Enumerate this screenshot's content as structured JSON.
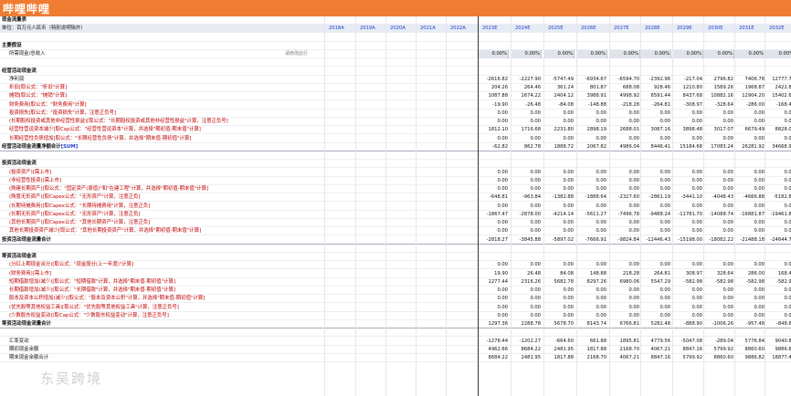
{
  "app_title": "哔哩哔哩",
  "sheet_title": "现金流量表",
  "unit_label": "单位：百万元人民币（特别说明除外）",
  "years": [
    "2018A",
    "2019A",
    "2020A",
    "2021A",
    "2022A",
    "2023E",
    "2024E",
    "2025E",
    "2026E",
    "2027E",
    "2028E",
    "2029E",
    "2030E",
    "2031E",
    "2032E"
  ],
  "percent_row_note": "请修改此行",
  "rows": [
    {
      "label": "",
      "style": ""
    },
    {
      "label": "主要假设",
      "style": "bold"
    },
    {
      "label": "所需现金/总收入",
      "style": "i1",
      "note": "请修改此行",
      "pct": true,
      "values": [
        "",
        "",
        "",
        "",
        "",
        "0.00%",
        "0.00%",
        "0.00%",
        "0.00%",
        "0.00%",
        "0.00%",
        "0.00%",
        "0.00%",
        "0.00%",
        "0.00%"
      ]
    },
    {
      "label": "",
      "style": ""
    },
    {
      "label": "经营活动现金流",
      "style": "bold"
    },
    {
      "label": "净利润",
      "style": "i1",
      "values": [
        "",
        "",
        "",
        "",
        "",
        "-2616.82",
        "-2227.90",
        "-5747.49",
        "-6934.67",
        "-6594.70",
        "-2392.96",
        "-217.04",
        "2796.82",
        "7406.78",
        "12777.78"
      ]
    },
    {
      "label": "折旧[取公式：\"折旧\"计算]",
      "style": "i1 red",
      "values": [
        "",
        "",
        "",
        "",
        "",
        "204.26",
        "264.46",
        "361.24",
        "801.87",
        "688.08",
        "928.46",
        "1210.80",
        "1589.26",
        "1968.87",
        "2422.87"
      ]
    },
    {
      "label": "摊销[取公式：\"摊销\"计算]",
      "style": "i1 red",
      "values": [
        "",
        "",
        "",
        "",
        "",
        "1087.88",
        "1674.22",
        "2404.12",
        "3988.91",
        "4998.92",
        "6591.44",
        "8437.68",
        "10882.16",
        "12904.20",
        "15402.68"
      ]
    },
    {
      "label": "财务费用[取公式：\"财务费用\"计算]",
      "style": "i1 red",
      "values": [
        "",
        "",
        "",
        "",
        "",
        "-19.90",
        "-26.48",
        "-84.08",
        "-148.88",
        "-218.28",
        "-264.81",
        "-308.97",
        "-328.64",
        "-286.00",
        "-168.46"
      ]
    },
    {
      "label": "投资损失[取公式：\"投资损失\"计算，注意正负号]",
      "style": "i1 red",
      "values": [
        "",
        "",
        "",
        "",
        "",
        "0.00",
        "0.00",
        "0.00",
        "0.00",
        "0.00",
        "0.00",
        "0.00",
        "0.00",
        "0.00",
        "0.00"
      ]
    },
    {
      "label": "(长期股权投资或其他非经营性损益)[取公式：\"长期股权投资或其他非经营性损益\"计算，注意正负号]",
      "style": "i1 red",
      "values": [
        "",
        "",
        "",
        "",
        "",
        "0.00",
        "0.00",
        "0.00",
        "0.00",
        "0.00",
        "0.00",
        "0.00",
        "0.00",
        "0.00",
        "0.00"
      ]
    },
    {
      "label": "经营性营运资本减少[取Cap公式：\"经营性营运资本\"计算，并选择\"期初值-期末值\"计算]",
      "style": "i1 red",
      "values": [
        "",
        "",
        "",
        "",
        "",
        "1812.10",
        "1716.68",
        "2231.80",
        "2898.19",
        "2688.01",
        "3087.16",
        "3898.48",
        "3017.07",
        "6679.49",
        "8828.07"
      ]
    },
    {
      "label": "长期经营性负债增加[取公式：\"长期经营性负债\"计算，并选择\"期末值-期初值\"计算]",
      "style": "i1 red",
      "values": [
        "",
        "",
        "",
        "",
        "",
        "0.00",
        "0.00",
        "0.00",
        "0.00",
        "0.00",
        "0.00",
        "0.00",
        "0.00",
        "0.00",
        "0.00"
      ]
    },
    {
      "label": "经营活动现金流量净额合计[SUM]",
      "style": "bold sum",
      "blueSuffix": "[SUM]",
      "values": [
        "",
        "",
        "",
        "",
        "",
        "-62.82",
        "862.78",
        "1888.72",
        "2067.82",
        "4986.04",
        "8446.41",
        "15184.68",
        "17083.24",
        "26281.92",
        "34668.98"
      ]
    },
    {
      "label": "",
      "style": ""
    },
    {
      "label": "投资活动现金流",
      "style": "bold"
    },
    {
      "label": "(投资资产)[需上市]",
      "style": "i1 red",
      "values": [
        "",
        "",
        "",
        "",
        "",
        "0.00",
        "0.00",
        "0.00",
        "0.00",
        "0.00",
        "0.00",
        "0.00",
        "0.00",
        "0.00",
        "0.00"
      ]
    },
    {
      "label": "(非经营性投资)[需上市]",
      "style": "i1 red",
      "values": [
        "",
        "",
        "",
        "",
        "",
        "0.00",
        "0.00",
        "0.00",
        "0.00",
        "0.00",
        "0.00",
        "0.00",
        "0.00",
        "0.00",
        "0.00"
      ]
    },
    {
      "label": "(购建长期资产)[取公式：\"固定资产(原值)\"和\"在建工程\"计算，并选择\"期初值-期末值\"计算]",
      "style": "i1 red",
      "values": [
        "",
        "",
        "",
        "",
        "",
        "0.00",
        "0.00",
        "0.00",
        "0.00",
        "0.00",
        "0.00",
        "0.00",
        "0.00",
        "0.00",
        "0.00"
      ]
    },
    {
      "label": "(购置无形资产)[取Capex公式：\"无形资产\"计算，注意正负]",
      "style": "i1 red",
      "values": [
        "",
        "",
        "",
        "",
        "",
        "-648.81",
        "-963.84",
        "-1382.88",
        "-1888.64",
        "-2327.60",
        "-2861.19",
        "-3441.10",
        "-4048.43",
        "-4666.88",
        "-5182.84"
      ]
    },
    {
      "label": "(长期待摊费用)[取Capex公式：\"长期待摊费用\"计算，注意正负]",
      "style": "i1 red",
      "values": [
        "",
        "",
        "",
        "",
        "",
        "0.00",
        "0.00",
        "0.00",
        "0.00",
        "0.00",
        "0.00",
        "0.00",
        "0.00",
        "0.00",
        "0.00"
      ]
    },
    {
      "label": "(长期无形资产)[取Capex公式：\"无形资产\"计算，注意正负]",
      "style": "i1 red",
      "values": [
        "",
        "",
        "",
        "",
        "",
        "-1867.47",
        "-2878.00",
        "-4214.14",
        "-5611.27",
        "-7496.78",
        "-9488.24",
        "-11781.70",
        "-14088.74",
        "-16881.87",
        "-19461.88"
      ]
    },
    {
      "label": "(其他长期资产)[取Capex公式：\"其他长期资产\"计算，注意正负]",
      "style": "i1 red",
      "values": [
        "",
        "",
        "",
        "",
        "",
        "0.00",
        "0.00",
        "0.00",
        "0.00",
        "0.00",
        "0.00",
        "0.00",
        "0.00",
        "0.00",
        "0.00"
      ]
    },
    {
      "label": "其他长期投资资产减少[取公式：\"其他长期投资资产\"计算，并选择\"期初值-期末值\"计算]",
      "style": "i1 red",
      "values": [
        "",
        "",
        "",
        "",
        "",
        "0.00",
        "0.00",
        "0.00",
        "0.00",
        "0.00",
        "0.00",
        "0.00",
        "0.00",
        "0.00",
        "0.00"
      ]
    },
    {
      "label": "投资活动现金流量合计",
      "style": "bold sum",
      "values": [
        "",
        "",
        "",
        "",
        "",
        "-2818.27",
        "-3845.88",
        "-5897.02",
        "-7666.91",
        "-9824.84",
        "-12446.43",
        "-15198.00",
        "-18082.22",
        "-21488.18",
        "-24644.72"
      ]
    },
    {
      "label": "",
      "style": ""
    },
    {
      "label": "筹资活动现金流",
      "style": "bold"
    },
    {
      "label": "(分红上期现金派分)[取公式：\"现金股分(上一年度)\"计算]",
      "style": "i1 red",
      "values": [
        "",
        "",
        "",
        "",
        "",
        "0.00",
        "0.00",
        "0.00",
        "0.00",
        "0.00",
        "0.00",
        "0.00",
        "0.00",
        "0.00",
        "0.00"
      ]
    },
    {
      "label": "(财务费用)[需上市]",
      "style": "i1 red",
      "values": [
        "",
        "",
        "",
        "",
        "",
        "19.90",
        "26.48",
        "84.08",
        "148.88",
        "218.28",
        "264.81",
        "308.97",
        "328.64",
        "286.00",
        "168.46"
      ]
    },
    {
      "label": "短期借款增加(减少)[取公式：\"短期借款\"计算，并选择\"期末值-期初值\"计算]",
      "style": "i1 red",
      "values": [
        "",
        "",
        "",
        "",
        "",
        "1277.44",
        "2316.26",
        "5682.78",
        "8297.26",
        "6980.06",
        "5547.29",
        "-582.98",
        "-582.98",
        "-582.98",
        "-582.98"
      ]
    },
    {
      "label": "长期借款增加(减少)[取公式：\"长期借款\"计算，并选择\"期末值-期初值\"计算]",
      "style": "i1 red",
      "values": [
        "",
        "",
        "",
        "",
        "",
        "0.00",
        "0.00",
        "0.00",
        "0.00",
        "0.00",
        "0.00",
        "0.00",
        "0.00",
        "0.00",
        "0.00"
      ]
    },
    {
      "label": "股本及资本公积增加(减少)[取公式：\"股本及资本公积\"计算，并选择\"期末值-期初值\"计算]",
      "style": "i1 red",
      "values": [
        "",
        "",
        "",
        "",
        "",
        "0.00",
        "0.00",
        "0.00",
        "0.00",
        "0.00",
        "0.00",
        "0.00",
        "0.00",
        "0.00",
        "0.00"
      ]
    },
    {
      "label": "(优先股等其他权益工具)[取公式：\"优先股等其他权益工具\"计算，注意正负号]",
      "style": "i1 red",
      "values": [
        "",
        "",
        "",
        "",
        "",
        "0.00",
        "0.00",
        "0.00",
        "0.00",
        "0.00",
        "0.00",
        "0.00",
        "0.00",
        "0.00",
        "0.00"
      ]
    },
    {
      "label": "(少数股东权益变动)[取Cap公式：\"少数股东权益变动\"计算，注意正负号]",
      "style": "i1 red",
      "values": [
        "",
        "",
        "",
        "",
        "",
        "0.00",
        "0.00",
        "0.00",
        "0.00",
        "0.00",
        "0.00",
        "0.00",
        "0.00",
        "0.00",
        "0.00"
      ]
    },
    {
      "label": "筹资活动现金流量合计",
      "style": "bold sum",
      "values": [
        "",
        "",
        "",
        "",
        "",
        "1297.36",
        "2288.78",
        "5678.70",
        "8143.74",
        "6766.81",
        "5282.48",
        "-888.90",
        "-1006.26",
        "-957.48",
        "-848.69"
      ]
    },
    {
      "label": "",
      "style": ""
    },
    {
      "label": "汇率变动",
      "style": "i1",
      "values": [
        "",
        "",
        "",
        "",
        "",
        "-1278.44",
        "-1202.27",
        "-664.60",
        "661.88",
        "1895.81",
        "4779.56",
        "-5047.08",
        "-289.04",
        "5776.84",
        "9040.83"
      ]
    },
    {
      "label": "期初现金余额",
      "style": "i1",
      "values": [
        "",
        "",
        "",
        "",
        "",
        "4962.66",
        "8684.22",
        "2481.95",
        "1817.88",
        "2168.70",
        "4067.21",
        "8847.16",
        "5799.92",
        "8860.60",
        "9886.82"
      ]
    },
    {
      "label": "期末现金余额合计",
      "style": "i1",
      "values": [
        "",
        "",
        "",
        "",
        "",
        "8684.22",
        "2481.95",
        "1817.88",
        "2168.70",
        "4067.21",
        "8847.16",
        "5799.92",
        "8860.60",
        "9886.82",
        "18877.45"
      ]
    }
  ],
  "watermark": "东吴跨境"
}
